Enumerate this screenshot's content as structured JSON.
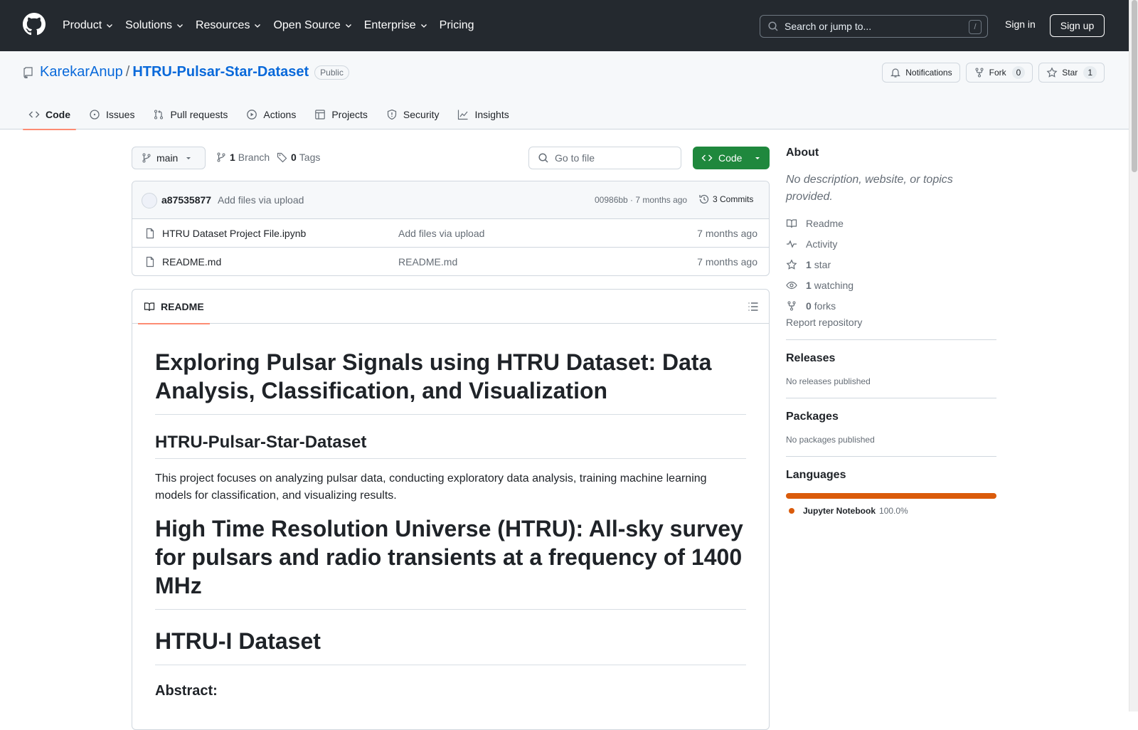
{
  "header": {
    "nav": [
      {
        "label": "Product",
        "has_menu": true
      },
      {
        "label": "Solutions",
        "has_menu": true
      },
      {
        "label": "Resources",
        "has_menu": true
      },
      {
        "label": "Open Source",
        "has_menu": true
      },
      {
        "label": "Enterprise",
        "has_menu": true
      },
      {
        "label": "Pricing",
        "has_menu": false
      }
    ],
    "search_placeholder": "Search or jump to...",
    "search_shortcut": "/",
    "signin_label": "Sign in",
    "signup_label": "Sign up"
  },
  "repo": {
    "owner": "KarekarAnup",
    "separator": "/",
    "name": "HTRU-Pulsar-Star-Dataset",
    "visibility": "Public",
    "notifications_label": "Notifications",
    "fork_label": "Fork",
    "fork_count": "0",
    "star_label": "Star",
    "star_count": "1",
    "tabs": [
      {
        "label": "Code",
        "icon": "code-icon",
        "active": true
      },
      {
        "label": "Issues",
        "icon": "issue-icon",
        "active": false
      },
      {
        "label": "Pull requests",
        "icon": "pull-request-icon",
        "active": false
      },
      {
        "label": "Actions",
        "icon": "play-icon",
        "active": false
      },
      {
        "label": "Projects",
        "icon": "table-icon",
        "active": false
      },
      {
        "label": "Security",
        "icon": "shield-icon",
        "active": false
      },
      {
        "label": "Insights",
        "icon": "graph-icon",
        "active": false
      }
    ]
  },
  "code": {
    "branch": "main",
    "branch_count": "1",
    "branch_label": "Branch",
    "tag_count": "0",
    "tag_label": "Tags",
    "goto_placeholder": "Go to file",
    "code_button_label": "Code",
    "commit": {
      "author": "a87535877",
      "message": "Add files via upload",
      "meta": "00986bb · 7 months ago",
      "commits_label": "3 Commits"
    },
    "files": [
      {
        "name": "HTRU Dataset Project File.ipynb",
        "message": "Add files via upload",
        "time": "7 months ago"
      },
      {
        "name": "README.md",
        "message": "README.md",
        "time": "7 months ago"
      }
    ]
  },
  "readme": {
    "tab_label": "README",
    "h1": "Exploring Pulsar Signals using HTRU Dataset: Data Analysis, Classification, and Visualization",
    "h2": "HTRU-Pulsar-Star-Dataset",
    "paragraph": "This project focuses on analyzing pulsar data, conducting exploratory data analysis, training machine learning models for classification, and visualizing results.",
    "h1_b": "High Time Resolution Universe (HTRU): All-sky survey for pulsars and radio transients at a frequency of 1400 MHz",
    "h1_c": "HTRU-I Dataset",
    "h3": "Abstract:"
  },
  "sidebar": {
    "about_title": "About",
    "description": "No description, website, or topics provided.",
    "items": [
      {
        "count": "",
        "label": "Readme",
        "icon": "book-icon"
      },
      {
        "count": "",
        "label": "Activity",
        "icon": "pulse-icon"
      },
      {
        "count": "1",
        "label": "star",
        "icon": "star-icon"
      },
      {
        "count": "1",
        "label": "watching",
        "icon": "eye-icon"
      },
      {
        "count": "0",
        "label": "forks",
        "icon": "fork-icon"
      }
    ],
    "report_label": "Report repository",
    "releases_title": "Releases",
    "releases_text": "No releases published",
    "packages_title": "Packages",
    "packages_text": "No packages published",
    "languages_title": "Languages",
    "languages": [
      {
        "name": "Jupyter Notebook",
        "percent": "100.0%",
        "share": 1.0,
        "color": "#DA5B0B"
      }
    ]
  },
  "colors": {
    "header_bg": "#24292f",
    "link": "#0969da",
    "primary_button": "#1f883d",
    "active_tab_underline": "#fd8c73"
  }
}
